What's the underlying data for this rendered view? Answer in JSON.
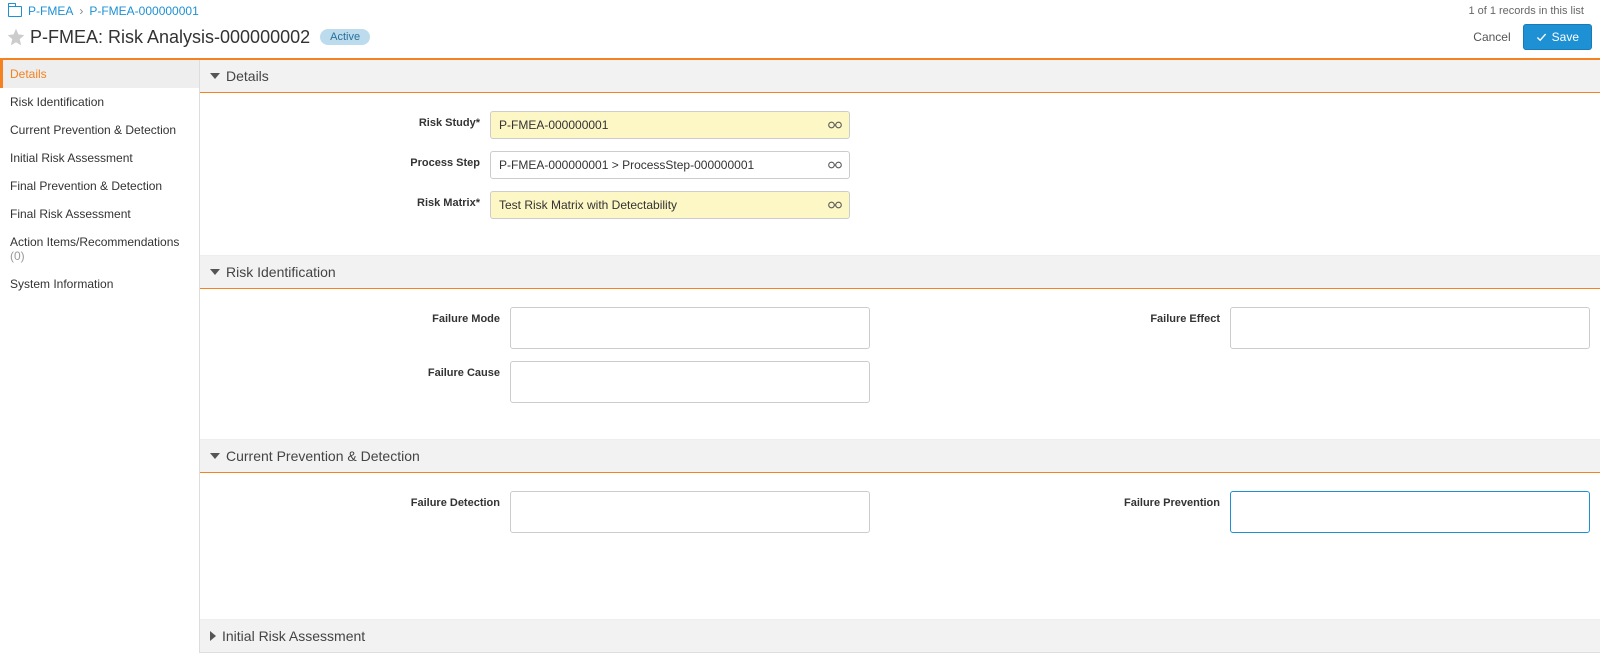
{
  "breadcrumb": {
    "root": "P-FMEA",
    "current": "P-FMEA-000000001"
  },
  "records_count_text": "1 of 1 records in this list",
  "page_title": "P-FMEA: Risk Analysis-000000002",
  "status": "Active",
  "actions": {
    "cancel": "Cancel",
    "save": "Save"
  },
  "sidebar": {
    "items": [
      {
        "label": "Details"
      },
      {
        "label": "Risk Identification"
      },
      {
        "label": "Current Prevention & Detection"
      },
      {
        "label": "Initial Risk Assessment"
      },
      {
        "label": "Final Prevention & Detection"
      },
      {
        "label": "Final Risk Assessment"
      },
      {
        "label": "Action Items/Recommendations",
        "count": "(0)"
      },
      {
        "label": "System Information"
      }
    ]
  },
  "sections": {
    "details": {
      "title": "Details",
      "fields": {
        "risk_study": {
          "label": "Risk Study*",
          "value": "P-FMEA-000000001"
        },
        "process_step": {
          "label": "Process Step",
          "value": "P-FMEA-000000001 > ProcessStep-000000001"
        },
        "risk_matrix": {
          "label": "Risk Matrix*",
          "value": "Test Risk Matrix with Detectability"
        }
      }
    },
    "risk_identification": {
      "title": "Risk Identification",
      "fields": {
        "failure_mode": {
          "label": "Failure Mode",
          "value": ""
        },
        "failure_effect": {
          "label": "Failure Effect",
          "value": ""
        },
        "failure_cause": {
          "label": "Failure Cause",
          "value": ""
        }
      }
    },
    "current_prevention": {
      "title": "Current Prevention & Detection",
      "fields": {
        "failure_detection": {
          "label": "Failure Detection",
          "value": ""
        },
        "failure_prevention": {
          "label": "Failure Prevention",
          "value": ""
        }
      }
    },
    "initial_risk": {
      "title": "Initial Risk Assessment"
    }
  }
}
